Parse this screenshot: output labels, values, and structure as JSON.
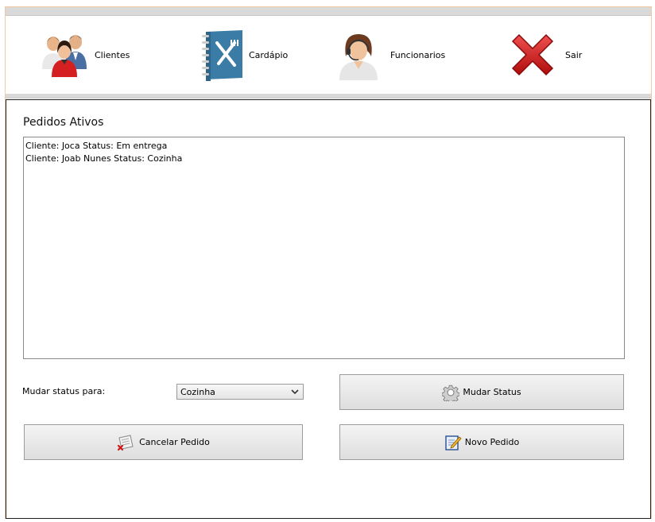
{
  "toolbar": {
    "items": [
      {
        "label": "Clientes",
        "icon": "users-icon"
      },
      {
        "label": "Cardápio",
        "icon": "menu-book-icon"
      },
      {
        "label": "Funcionarios",
        "icon": "attendant-icon"
      },
      {
        "label": "Sair",
        "icon": "red-x-icon"
      }
    ]
  },
  "orders": {
    "title": "Pedidos Ativos",
    "items": [
      "Cliente: Joca Status: Em entrega",
      "Cliente: Joab Nunes Status: Cozinha"
    ]
  },
  "status": {
    "label": "Mudar status para:",
    "selected": "Cozinha"
  },
  "buttons": {
    "change_status": "Mudar Status",
    "cancel_order": "Cancelar Pedido",
    "new_order": "Novo Pedido"
  },
  "colors": {
    "accent_border": "#f2c9a3",
    "menu_blue": "#3a7ca5",
    "exit_red": "#d01818"
  }
}
